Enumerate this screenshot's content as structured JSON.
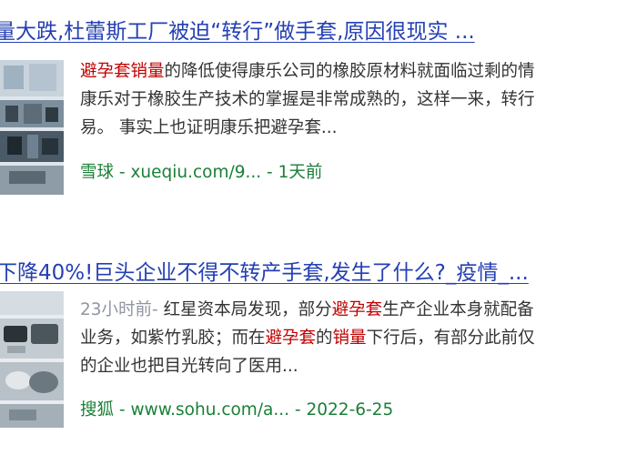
{
  "results": [
    {
      "title": "量大跌,杜蕾斯工厂被迫“转行”做手套,原因很现实 ...",
      "snippet_line1_highlight": "避孕套销量",
      "snippet_line1_rest": "的降低使得康乐公司的橡胶原材料就面临过剩的情",
      "snippet_line2": "康乐对于橡胶生产技术的掌握是非常成熟的，这样一来，转行",
      "snippet_line3": "易。 事实上也证明康乐把避孕套...",
      "source_site": "雪球",
      "source_url": "xueqiu.com/9...",
      "source_date": "1天前"
    },
    {
      "title": "下降40%!巨头企业不得不转产手套,发生了什么?_疫情_...",
      "time": "23小时前-",
      "snippet_line1_a": " 红星资本局发现，部分",
      "snippet_line1_highlight": "避孕套",
      "snippet_line1_b": "生产企业本身就配备",
      "snippet_line2_a": "业务，如紫竹乳胶；而在",
      "snippet_line2_highlight1": "避孕套",
      "snippet_line2_mid": "的",
      "snippet_line2_highlight2": "销量",
      "snippet_line2_b": "下行后，有部分此前仅",
      "snippet_line3": "的企业也把目光转向了医用...",
      "source_site": "搜狐",
      "source_url": "www.sohu.com/a...",
      "source_date": "2022-6-25"
    }
  ],
  "separator": " - "
}
